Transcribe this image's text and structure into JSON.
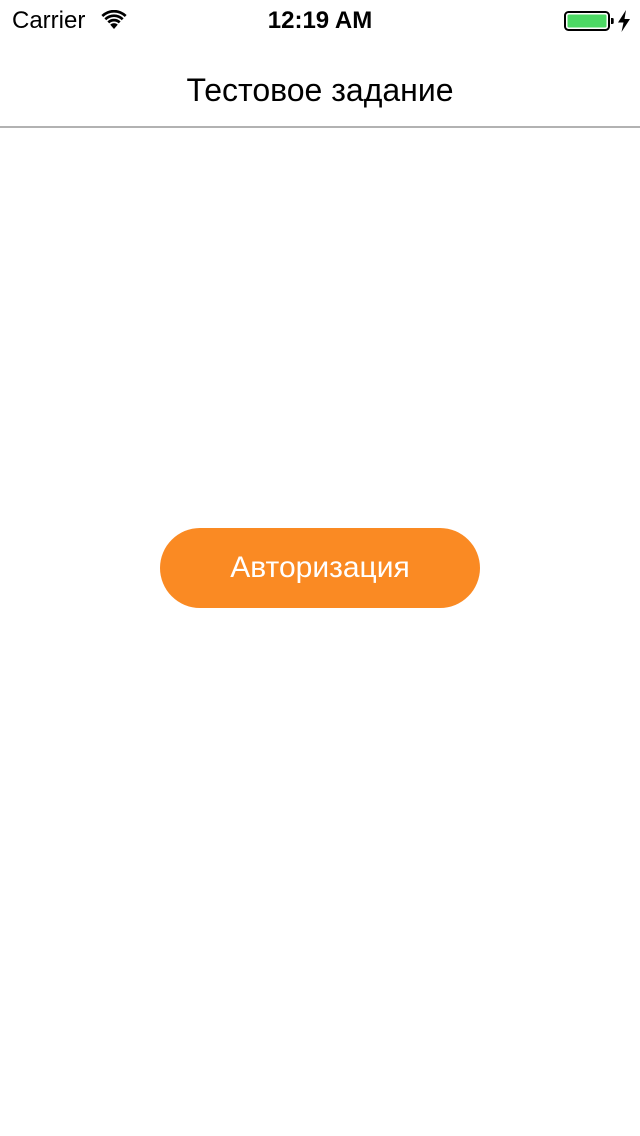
{
  "status_bar": {
    "carrier": "Carrier",
    "time": "12:19 AM",
    "wifi_icon": "wifi-icon",
    "battery_icon": "battery-full-icon",
    "charging_icon": "charging-bolt-icon",
    "battery_color": "#4cd964"
  },
  "nav_bar": {
    "title": "Тестовое задание"
  },
  "main": {
    "auth_button_label": "Авторизация",
    "accent_color": "#fa8a23"
  }
}
